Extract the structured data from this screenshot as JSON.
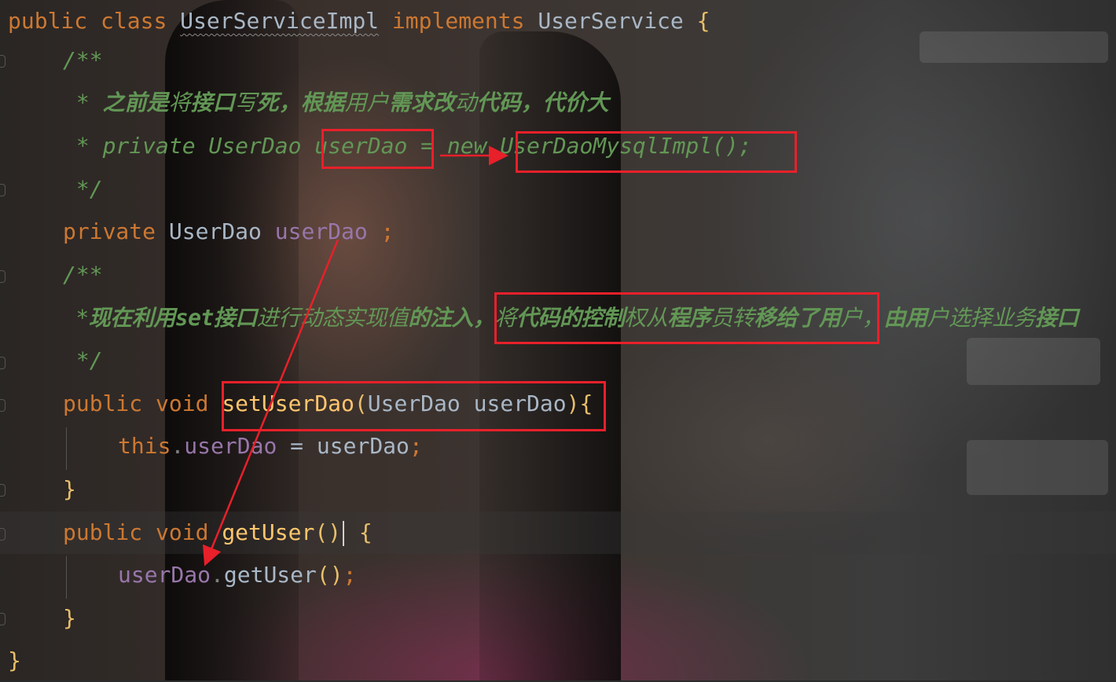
{
  "editor": {
    "theme_colors": {
      "keyword": "#cc7832",
      "comment": "#629755",
      "field": "#9876aa",
      "method": "#ffc66d",
      "default_text": "#a9b7c6",
      "annotation_box": "#e8202a"
    },
    "lines": {
      "l1": {
        "kw1": "public",
        "kw2": "class",
        "name": "UserServiceImpl",
        "kw3": "implements",
        "iface": "UserService",
        "brace": "{"
      },
      "l2": {
        "text": "/**"
      },
      "l3": {
        "star": " * ",
        "a": "之前是",
        "b": "将",
        "c": "接口",
        "d": "写",
        "e": "死，根据",
        "f": "用",
        "g": "户",
        "h": "需求改",
        "i": "动",
        "j": "代码，代价大"
      },
      "l4": {
        "p1": " * private UserDao ",
        "p2": "userDao",
        "p3": " = new ",
        "p4": "UserDaoMysqlImpl();"
      },
      "l5": {
        "text": " */"
      },
      "l6": {
        "kw": "private",
        "type": "UserDao",
        "field": "userDao",
        "semi": " ;"
      },
      "l7": {
        "text": "/**"
      },
      "l8": {
        "star": " *",
        "a": "现在利用set接口",
        "b": "进行动态实现值",
        "c": "的注入，",
        "d": "将",
        "e": "代码的控制",
        "f": "权从",
        "g": "程序",
        "h": "员转",
        "i": "移给了用",
        "j": "户，",
        "k": "由用",
        "l": "户选择业务",
        "m": "接口"
      },
      "l9": {
        "text": " */"
      },
      "l10": {
        "kw1": "public",
        "kw2": "void",
        "fn": "setUserDao",
        "open": "(",
        "type": "UserDao",
        "param": "userDao",
        "close": ")",
        "brace": "{"
      },
      "l11": {
        "this": "this",
        "dot": ".",
        "field": "userDao",
        "eq": " = ",
        "param": "userDao",
        "semi": ";"
      },
      "l12": {
        "text": "}"
      },
      "l13": {
        "kw1": "public",
        "kw2": "void",
        "fn": "getUser",
        "parens": "()",
        "brace": "{"
      },
      "l14": {
        "field": "userDao",
        "dot": ".",
        "fn": "getUser",
        "parens": "()",
        "semi": ";"
      },
      "l15": {
        "text": "}"
      },
      "l16": {
        "text": "}"
      }
    }
  }
}
